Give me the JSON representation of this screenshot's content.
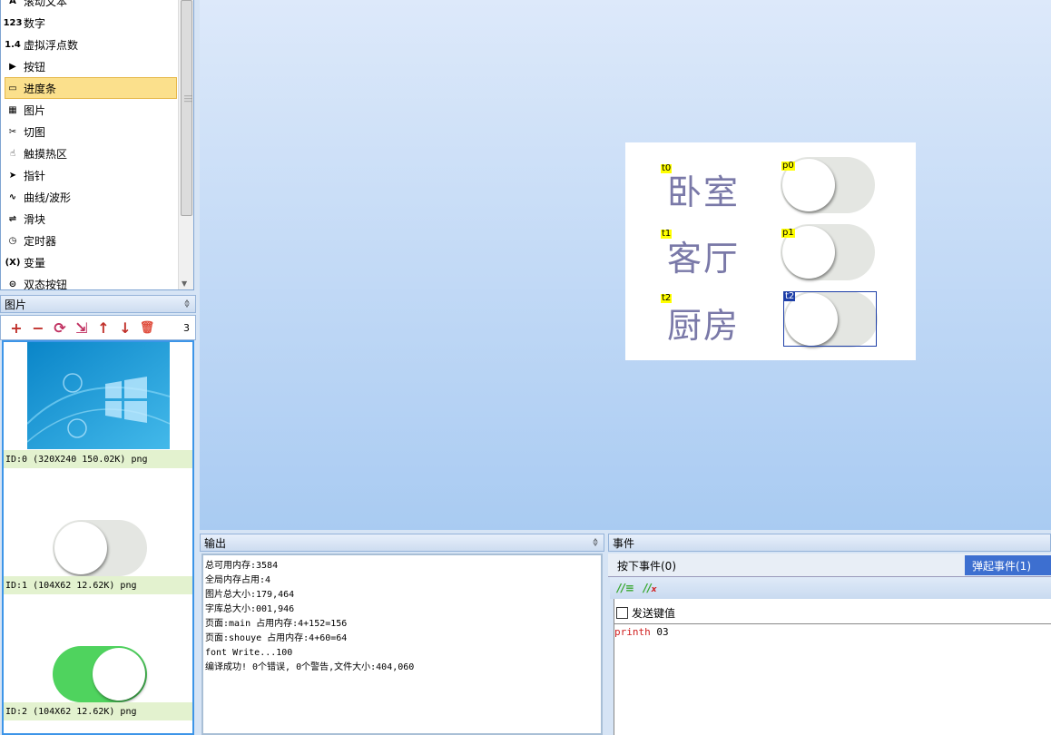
{
  "toolbox": {
    "items": [
      {
        "label": "滚动文本",
        "icon": "scroll-text-icon",
        "glyph": "A"
      },
      {
        "label": "数字",
        "icon": "number-icon",
        "glyph": "123"
      },
      {
        "label": "虚拟浮点数",
        "icon": "float-icon",
        "glyph": "1.4"
      },
      {
        "label": "按钮",
        "icon": "button-icon",
        "glyph": "▶"
      },
      {
        "label": "进度条",
        "icon": "progress-bar-icon",
        "glyph": "▭",
        "selected": true
      },
      {
        "label": "图片",
        "icon": "picture-icon",
        "glyph": "▦"
      },
      {
        "label": "切图",
        "icon": "scissors-icon",
        "glyph": "✂"
      },
      {
        "label": "触摸热区",
        "icon": "hand-icon",
        "glyph": "☝"
      },
      {
        "label": "指针",
        "icon": "pointer-icon",
        "glyph": "➤"
      },
      {
        "label": "曲线/波形",
        "icon": "wave-icon",
        "glyph": "∿"
      },
      {
        "label": "滑块",
        "icon": "slider-icon",
        "glyph": "⇌"
      },
      {
        "label": "定时器",
        "icon": "clock-icon",
        "glyph": "◷"
      },
      {
        "label": "变量",
        "icon": "variable-icon",
        "glyph": "(X)"
      },
      {
        "label": "双态按钮",
        "icon": "dual-state-button-icon",
        "glyph": "⊝"
      }
    ]
  },
  "pictures": {
    "title": "图片",
    "pin": "ᛰ",
    "count": "3",
    "toolbar": [
      "+",
      "−",
      "⟳",
      "⇲",
      "↑",
      "↓",
      "🗑"
    ],
    "items": [
      {
        "caption": "ID:0  (320X240 150.02K) png"
      },
      {
        "caption": "ID:1  (104X62 12.62K) png"
      },
      {
        "caption": "ID:2  (104X62 12.62K) png"
      }
    ]
  },
  "screen": {
    "rows": [
      {
        "label": "卧室",
        "tag": "t0",
        "switch_tag": "p0"
      },
      {
        "label": "客厅",
        "tag": "t1",
        "switch_tag": "p1"
      },
      {
        "label": "厨房",
        "tag": "t2",
        "switch_tag": "t2"
      }
    ]
  },
  "output": {
    "title": "输出",
    "pin": "ᛰ",
    "lines": [
      "总可用内存:3584",
      "全局内存占用:4",
      "图片总大小:179,464",
      "字库总大小:001,946",
      "页面:main 占用内存:4+152=156",
      "页面:shouye 占用内存:4+60=64",
      "font Write...100",
      "编译成功! 0个错误, 0个警告,文件大小:404,060"
    ]
  },
  "events": {
    "title": "事件",
    "tab_press": "按下事件(0)",
    "tab_release": "弹起事件(1)",
    "send_key": "发送键值",
    "code_keyword": "printh",
    "code_arg": " 03"
  },
  "colors": {
    "accent": "#3d6fd0",
    "label": "#7a79a8",
    "switch_on": "#4fd35e"
  }
}
